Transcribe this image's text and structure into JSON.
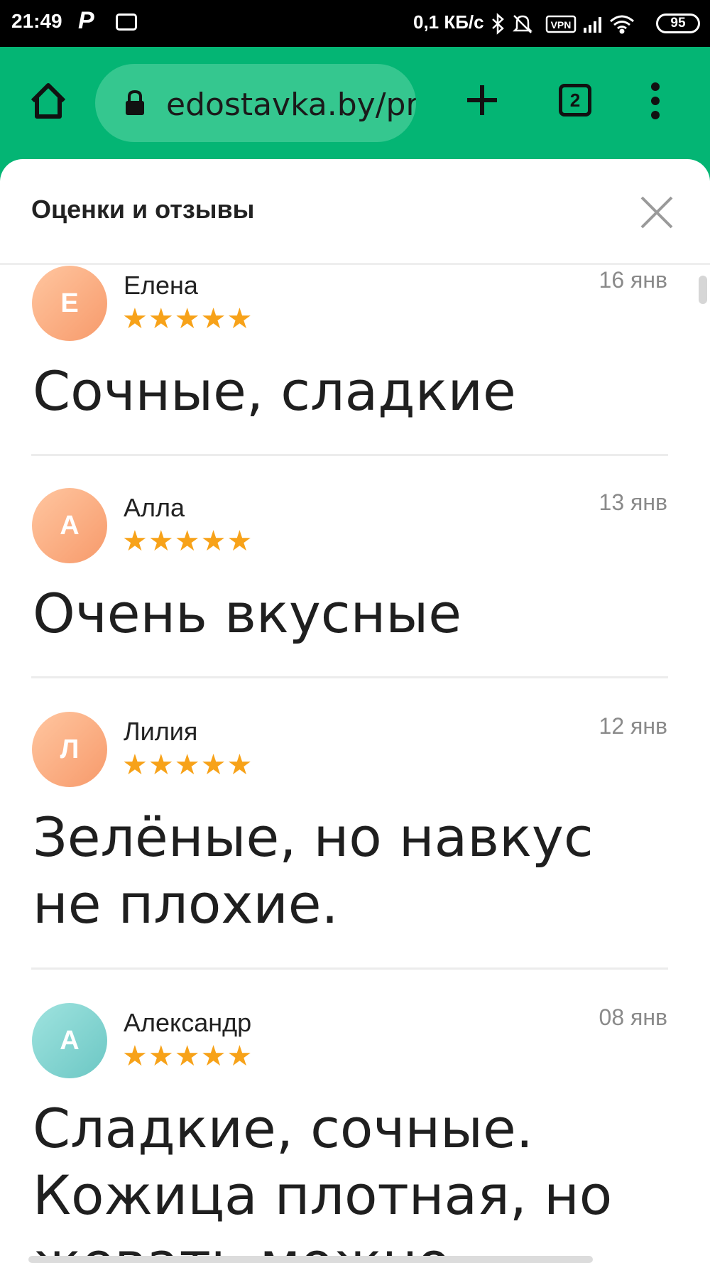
{
  "status_bar": {
    "time": "21:49",
    "app_letter": "P",
    "net_speed": "0,1 КБ/с",
    "battery": "95",
    "icons": [
      "vr-icon",
      "bluetooth-icon",
      "bell-off-icon",
      "vpn-icon",
      "signal-icon",
      "wifi-icon",
      "battery-icon"
    ],
    "vpn_label": "VPN"
  },
  "browser": {
    "url": "edostavka.by/product",
    "tab_count": "2",
    "accent_color": "#04b574"
  },
  "sheet": {
    "title": "Оценки и отзывы"
  },
  "reviews": [
    {
      "initial": "Е",
      "author": "Елена",
      "date": "16 янв",
      "rating": 5,
      "text": "Сочные, сладкие"
    },
    {
      "initial": "А",
      "author": "Алла",
      "date": "13 янв",
      "rating": 5,
      "text": "Очень вкусные"
    },
    {
      "initial": "Л",
      "author": "Лилия",
      "date": "12 янв",
      "rating": 5,
      "text": "Зелёные, но навкус не плохие."
    },
    {
      "initial": "А",
      "author": "Александр",
      "date": "08 янв",
      "rating": 5,
      "text": "Сладкие, сочные. Кожица плотная, но жевать можно"
    }
  ],
  "stars_glyph": "★★★★★"
}
